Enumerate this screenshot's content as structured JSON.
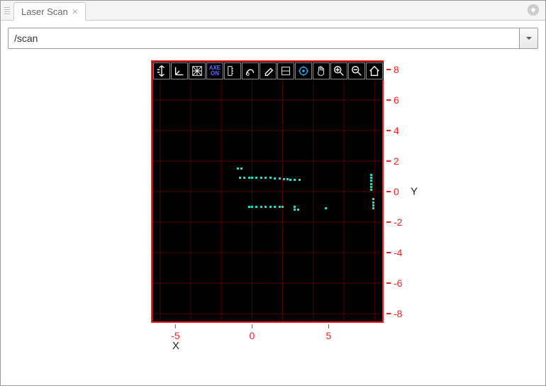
{
  "tab": {
    "title": "Laser Scan"
  },
  "topic_select": {
    "value": "/scan"
  },
  "icons": {
    "gear": "gear-icon",
    "close": "close-icon",
    "dropdown": "chevron-down-icon"
  },
  "toolbar": {
    "buttons": [
      "translate-icon",
      "axes3d-icon",
      "grid-icon",
      "axe-on-icon",
      "ruler-icon",
      "hand-draw-icon",
      "eraser-icon",
      "fit-icon",
      "target-icon",
      "pan-hand-icon",
      "zoom-in-icon",
      "zoom-out-icon",
      "home-icon"
    ],
    "axe_label_line1": "AXE",
    "axe_label_line2": "ON"
  },
  "chart_data": {
    "type": "scatter",
    "title": "",
    "xlabel": "X",
    "ylabel": "Y",
    "xlim": [
      -6.5,
      8.5
    ],
    "ylim": [
      -8.5,
      8.5
    ],
    "xticks": [
      -5,
      0,
      5
    ],
    "yticks": [
      -8,
      -6,
      -4,
      -2,
      0,
      2,
      4,
      6,
      8
    ],
    "grid": true,
    "series": [
      {
        "name": "scan",
        "color": "#2ad8c7",
        "points": [
          [
            -0.9,
            1.5
          ],
          [
            -0.7,
            1.5
          ],
          [
            -0.8,
            0.9
          ],
          [
            -0.5,
            0.9
          ],
          [
            -0.2,
            0.9
          ],
          [
            0.0,
            0.9
          ],
          [
            0.3,
            0.9
          ],
          [
            0.6,
            0.9
          ],
          [
            0.9,
            0.9
          ],
          [
            1.2,
            0.9
          ],
          [
            1.5,
            0.85
          ],
          [
            1.8,
            0.85
          ],
          [
            2.1,
            0.8
          ],
          [
            2.3,
            0.8
          ],
          [
            2.5,
            0.75
          ],
          [
            2.8,
            0.75
          ],
          [
            3.1,
            0.75
          ],
          [
            -0.2,
            -1.0
          ],
          [
            0.0,
            -1.0
          ],
          [
            0.3,
            -1.0
          ],
          [
            0.6,
            -1.0
          ],
          [
            0.9,
            -1.0
          ],
          [
            1.2,
            -1.0
          ],
          [
            1.5,
            -1.0
          ],
          [
            1.8,
            -1.0
          ],
          [
            2.0,
            -1.0
          ],
          [
            2.8,
            -1.2
          ],
          [
            2.8,
            -1.0
          ],
          [
            3.0,
            -1.2
          ],
          [
            4.8,
            -1.1
          ],
          [
            7.8,
            1.1
          ],
          [
            7.8,
            0.9
          ],
          [
            7.8,
            0.7
          ],
          [
            7.8,
            0.5
          ],
          [
            7.8,
            0.3
          ],
          [
            7.8,
            0.1
          ],
          [
            7.9,
            -0.5
          ],
          [
            7.9,
            -0.7
          ],
          [
            7.9,
            -0.9
          ],
          [
            7.9,
            -1.1
          ]
        ]
      }
    ]
  }
}
